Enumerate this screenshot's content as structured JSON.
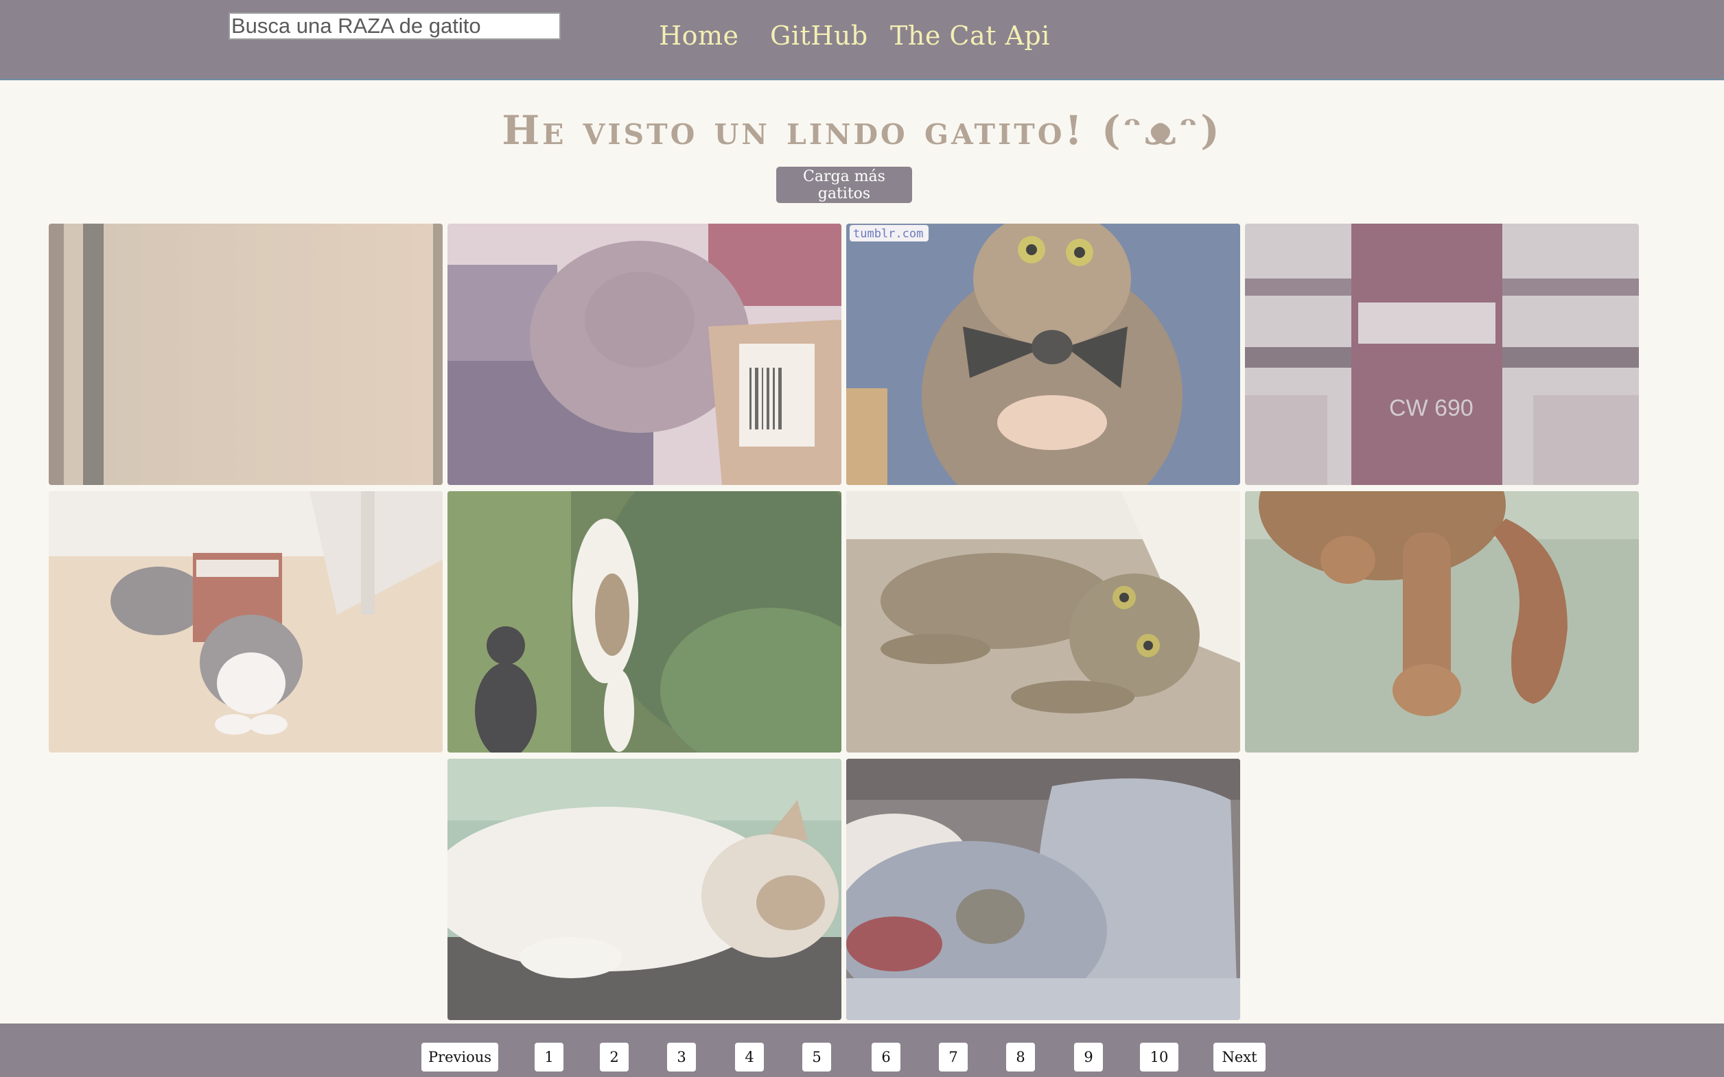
{
  "header": {
    "search": {
      "placeholder": "Busca una RAZA de gatito",
      "value": ""
    },
    "nav": {
      "home": "Home",
      "github": "GitHub",
      "catapi": "The Cat Api"
    }
  },
  "main": {
    "title": "He visto un lindo gatito! (ᵔᴥᵔ)",
    "load_more_label": "Carga más gatitos",
    "photos": [
      {
        "subject": "blurry beige wall"
      },
      {
        "subject": "fluffy cat in cardboard box"
      },
      {
        "subject": "tabby cat with bow tie",
        "overlay_text": "tumblr.com"
      },
      {
        "subject": "red object close-up",
        "overlay_text": "CW 690"
      },
      {
        "subject": "grey cat wearing a box"
      },
      {
        "subject": "cat climbing bush, black cat watching"
      },
      {
        "subject": "tabby kitten on carpet"
      },
      {
        "subject": "ginger cat paws and tail"
      },
      {
        "subject": "sleeping white and tabby cat"
      },
      {
        "subject": "cat in bed with pillows"
      }
    ]
  },
  "pagination": {
    "previous": "Previous",
    "pages": [
      "1",
      "2",
      "3",
      "4",
      "5",
      "6",
      "7",
      "8",
      "9",
      "10"
    ],
    "next": "Next"
  }
}
